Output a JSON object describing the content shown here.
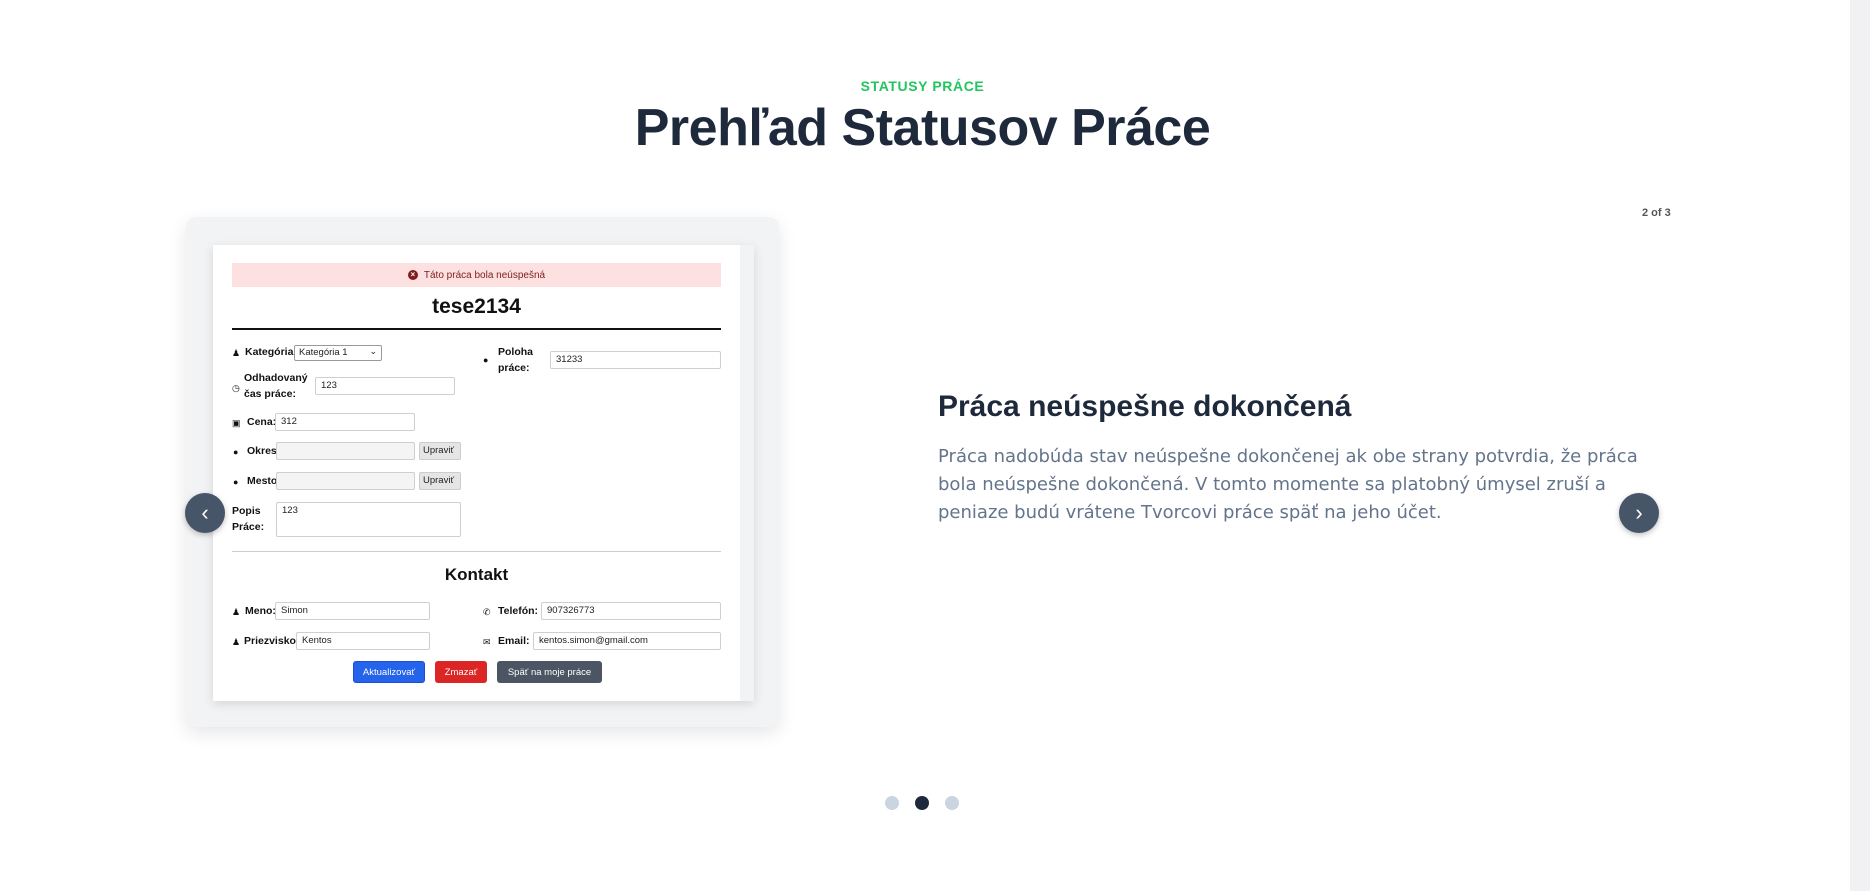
{
  "section": {
    "eyebrow": "STATUSY PRÁCE",
    "title": "Prehľad Statusov Práce"
  },
  "carousel": {
    "counter": "2 of 3",
    "prev_icon": "chevron-left",
    "next_icon": "chevron-right",
    "active_index": 1,
    "dots": 3
  },
  "preview": {
    "alert": "Táto práca bola neúspešná",
    "job_title": "tese2134",
    "fields": {
      "kategoria_label": "Kategória:",
      "kategoria_value": "Kategória 1",
      "poloha_label": "Poloha práce:",
      "poloha_value": "31233",
      "cas_label": "Odhadovaný čas práce:",
      "cas_value": "123",
      "cena_label": "Cena:",
      "cena_value": "312",
      "okres_label": "Okres:",
      "okres_value": "",
      "mesto_label": "Mesto:",
      "mesto_value": "",
      "upravit": "Upraviť",
      "popis_label": "Popis Práce:",
      "popis_value": "123"
    },
    "contact": {
      "heading": "Kontakt",
      "meno_label": "Meno:",
      "meno_value": "Simon",
      "telefon_label": "Telefón:",
      "telefon_value": "907326773",
      "priezvisko_label": "Priezvisko:",
      "priezvisko_value": "Kentos",
      "email_label": "Email:",
      "email_value": "kentos.simon@gmail.com"
    },
    "buttons": {
      "update": "Aktualizovať",
      "delete": "Zmazať",
      "back": "Späť na moje práce"
    }
  },
  "slide": {
    "heading": "Práca neúspešne dokončená",
    "text": "Práca nadobúda stav neúspešne dokončenej ak obe strany potvrdia, že práca bola neúspešne dokončená. V tomto momente sa platobný úmysel zruší a peniaze budú vrátene Tvorcovi práce späť na jeho účet."
  },
  "colors": {
    "accent_green": "#22c55e",
    "heading": "#1e293b",
    "body_text": "#64748b",
    "arrow_bg": "#475569",
    "dot_active": "#1e293b",
    "dot_inactive": "#cbd5e1"
  }
}
